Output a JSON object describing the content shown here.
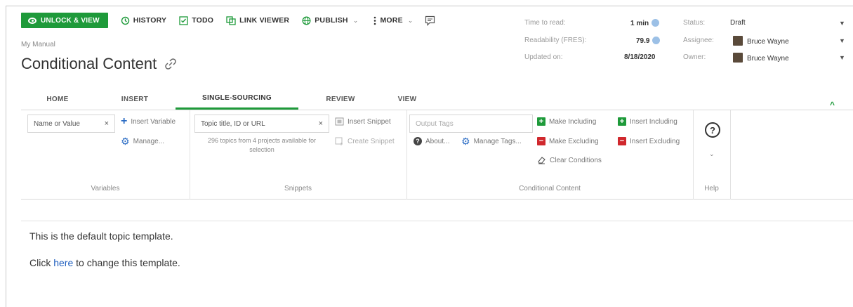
{
  "toolbar": {
    "unlock_label": "UNLOCK & VIEW",
    "history_label": "HISTORY",
    "todo_label": "TODO",
    "link_viewer_label": "LINK VIEWER",
    "publish_label": "PUBLISH",
    "more_label": "MORE",
    "accent_color": "#1e9a3a"
  },
  "header": {
    "manual_name": "My Manual",
    "topic_title": "Conditional Content"
  },
  "meta": {
    "time_to_read_label": "Time to read:",
    "time_to_read_value": "1 min",
    "readability_label": "Readability (FRES):",
    "readability_value": "79.9",
    "updated_label": "Updated on:",
    "updated_value": "8/18/2020",
    "status_label": "Status:",
    "status_value": "Draft",
    "assignee_label": "Assignee:",
    "assignee_value": "Bruce Wayne",
    "owner_label": "Owner:",
    "owner_value": "Bruce Wayne"
  },
  "tabs": [
    {
      "label": "HOME"
    },
    {
      "label": "INSERT"
    },
    {
      "label": "SINGLE-SOURCING",
      "active": true
    },
    {
      "label": "REVIEW"
    },
    {
      "label": "VIEW"
    }
  ],
  "ribbon": {
    "variables": {
      "input_value": "Name or Value",
      "insert_variable": "Insert Variable",
      "manage": "Manage...",
      "group_label": "Variables"
    },
    "snippets": {
      "input_value": "Topic title, ID or URL",
      "note": "296 topics from 4 projects available for selection",
      "insert_snippet": "Insert Snippet",
      "create_snippet": "Create Snippet",
      "group_label": "Snippets"
    },
    "conditional": {
      "output_tags_placeholder": "Output Tags",
      "about": "About...",
      "manage_tags": "Manage Tags...",
      "make_including": "Make Including",
      "make_excluding": "Make Excluding",
      "clear_conditions": "Clear Conditions",
      "insert_including": "Insert Including",
      "insert_excluding": "Insert Excluding",
      "group_label": "Conditional Content"
    },
    "help": {
      "icon_glyph": "?",
      "group_label": "Help"
    }
  },
  "content": {
    "line1": "This is the default topic template.",
    "line2_prefix": "Click ",
    "line2_link": "here",
    "line2_suffix": " to change this template."
  }
}
